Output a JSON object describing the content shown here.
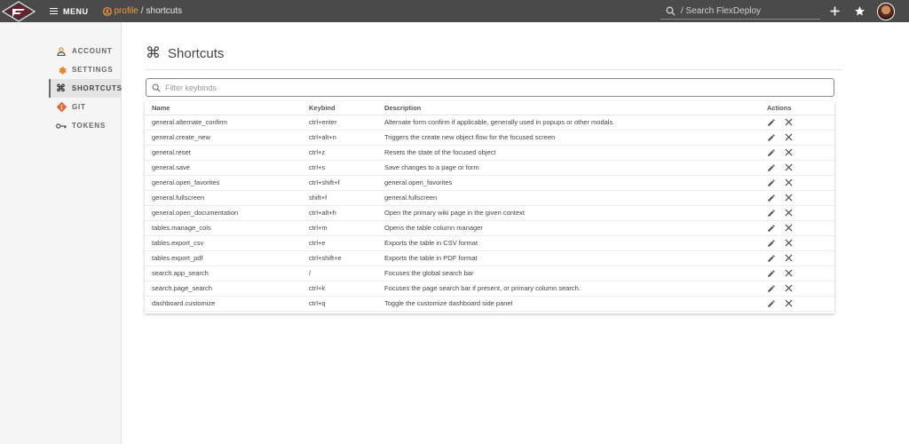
{
  "topbar": {
    "menu_label": "MENU",
    "breadcrumb": {
      "profile": "profile",
      "separator": "/",
      "current": "shortcuts"
    },
    "search_placeholder": "/ Search FlexDeploy"
  },
  "sidebar": {
    "items": [
      {
        "label": "ACCOUNT",
        "icon": "person-icon",
        "active": false
      },
      {
        "label": "SETTINGS",
        "icon": "gear-icon",
        "active": false
      },
      {
        "label": "SHORTCUTS",
        "icon": "command-key-icon",
        "active": true
      },
      {
        "label": "GIT",
        "icon": "git-icon",
        "active": false
      },
      {
        "label": "TOKENS",
        "icon": "key-icon",
        "active": false
      }
    ]
  },
  "main": {
    "title": "Shortcuts",
    "filter_placeholder": "Filter keybinds",
    "table": {
      "headers": {
        "name": "Name",
        "keybind": "Keybind",
        "description": "Description",
        "actions": "Actions"
      },
      "rows": [
        {
          "name": "general.alternate_confirm",
          "keybind": "ctrl+enter",
          "description": "Alternate form confirm if applicable, generally used in popups or other modals."
        },
        {
          "name": "general.create_new",
          "keybind": "ctrl+alt+n",
          "description": "Triggers the create new object flow for the focused screen"
        },
        {
          "name": "general.reset",
          "keybind": "ctrl+z",
          "description": "Resets the state of the focused object"
        },
        {
          "name": "general.save",
          "keybind": "ctrl+s",
          "description": "Save changes to a page or form"
        },
        {
          "name": "general.open_favorites",
          "keybind": "ctrl+shift+f",
          "description": "general.open_favorites"
        },
        {
          "name": "general.fullscreen",
          "keybind": "shift+f",
          "description": "general.fullscreen"
        },
        {
          "name": "general.open_documentation",
          "keybind": "ctrl+alt+h",
          "description": "Open the primary wiki page in the given context"
        },
        {
          "name": "tables.manage_cols",
          "keybind": "ctrl+m",
          "description": "Opens the table column manager"
        },
        {
          "name": "tables.export_csv",
          "keybind": "ctrl+e",
          "description": "Exports the table in CSV format"
        },
        {
          "name": "tables.export_pdf",
          "keybind": "ctrl+shift+e",
          "description": "Exports the table in PDF format"
        },
        {
          "name": "search.app_search",
          "keybind": "/",
          "description": "Focuses the global search bar"
        },
        {
          "name": "search.page_search",
          "keybind": "ctrl+k",
          "description": "Focuses the page search bar if present, or primary column search."
        },
        {
          "name": "dashboard.customize",
          "keybind": "ctrl+q",
          "description": "Toggle the customize dashboard side panel"
        }
      ]
    }
  },
  "colors": {
    "topbar": "#4a4a4a",
    "accent": "#f39c39",
    "sidebar_active": "#e4e4e4"
  }
}
